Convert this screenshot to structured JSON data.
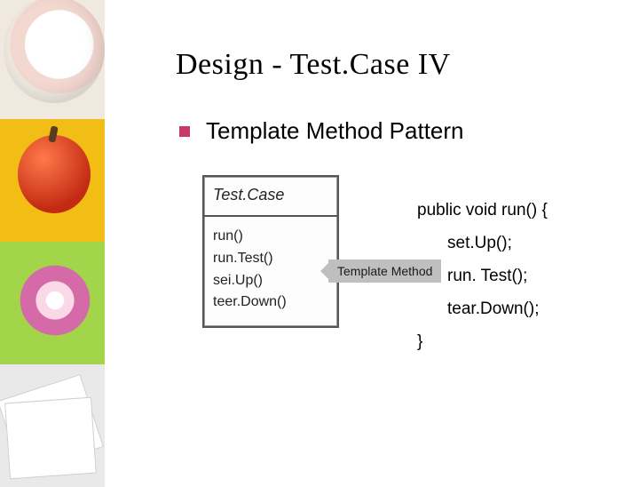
{
  "title": "Design - Test.Case IV",
  "bullet": "Template Method Pattern",
  "uml": {
    "class_name": "Test.Case",
    "methods": [
      "run()",
      "run.Test()",
      "sei.Up()",
      "teer.Down()"
    ]
  },
  "tag": "Template Method",
  "code": {
    "l0": "public void run() {",
    "l1": "set.Up();",
    "l2": "run. Test();",
    "l3": "tear.Down();",
    "l4": "}"
  }
}
